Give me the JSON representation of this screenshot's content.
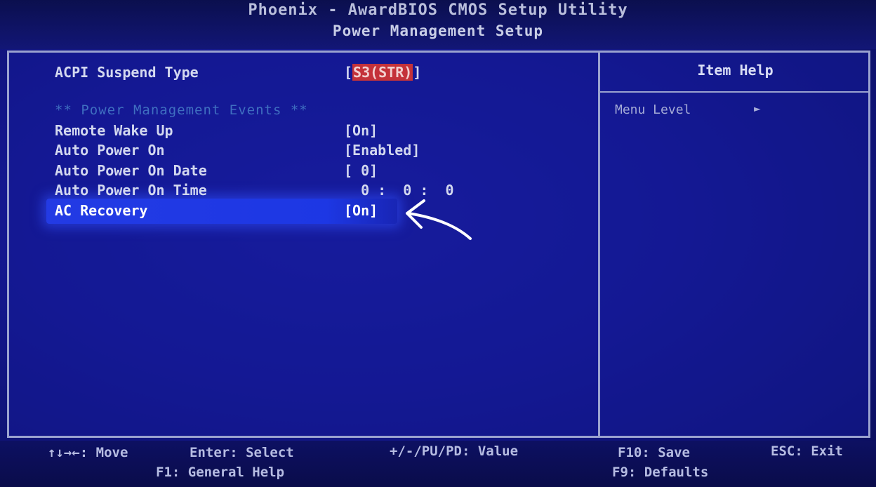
{
  "title": {
    "line1": "Phoenix - AwardBIOS CMOS Setup Utility",
    "line2": "Power Management Setup"
  },
  "settings": {
    "acpi_suspend": {
      "label": "ACPI Suspend Type",
      "bracket_open": "[",
      "value": "S3(STR)",
      "bracket_close": "]"
    },
    "section_heading": "** Power Management Events **",
    "items": [
      {
        "label": "Remote Wake Up",
        "value": "[On]"
      },
      {
        "label": "Auto Power On",
        "value": "[Enabled]"
      },
      {
        "label": "Auto Power On Date",
        "value": "[ 0]"
      },
      {
        "label": "Auto Power On Time",
        "value": "  0 :  0 :  0"
      },
      {
        "label": "AC Recovery",
        "value": "[On]"
      }
    ]
  },
  "help_panel": {
    "title": "Item Help",
    "menu_level_label": "Menu Level",
    "menu_level_arrow": "►"
  },
  "footer": {
    "move": "↑↓→←: Move",
    "enter": "Enter: Select",
    "value": "+/-/PU/PD: Value",
    "save": "F10: Save",
    "exit": "ESC: Exit",
    "general_help": "F1: General Help",
    "defaults": "F9: Defaults"
  },
  "colors": {
    "background": "#141891",
    "selection": "#2846ff",
    "acpi_highlight": "#c4323a",
    "section_heading": "#3f6fc0"
  },
  "icons": [
    "menu-level-arrow-icon",
    "annotation-arrow-icon"
  ]
}
